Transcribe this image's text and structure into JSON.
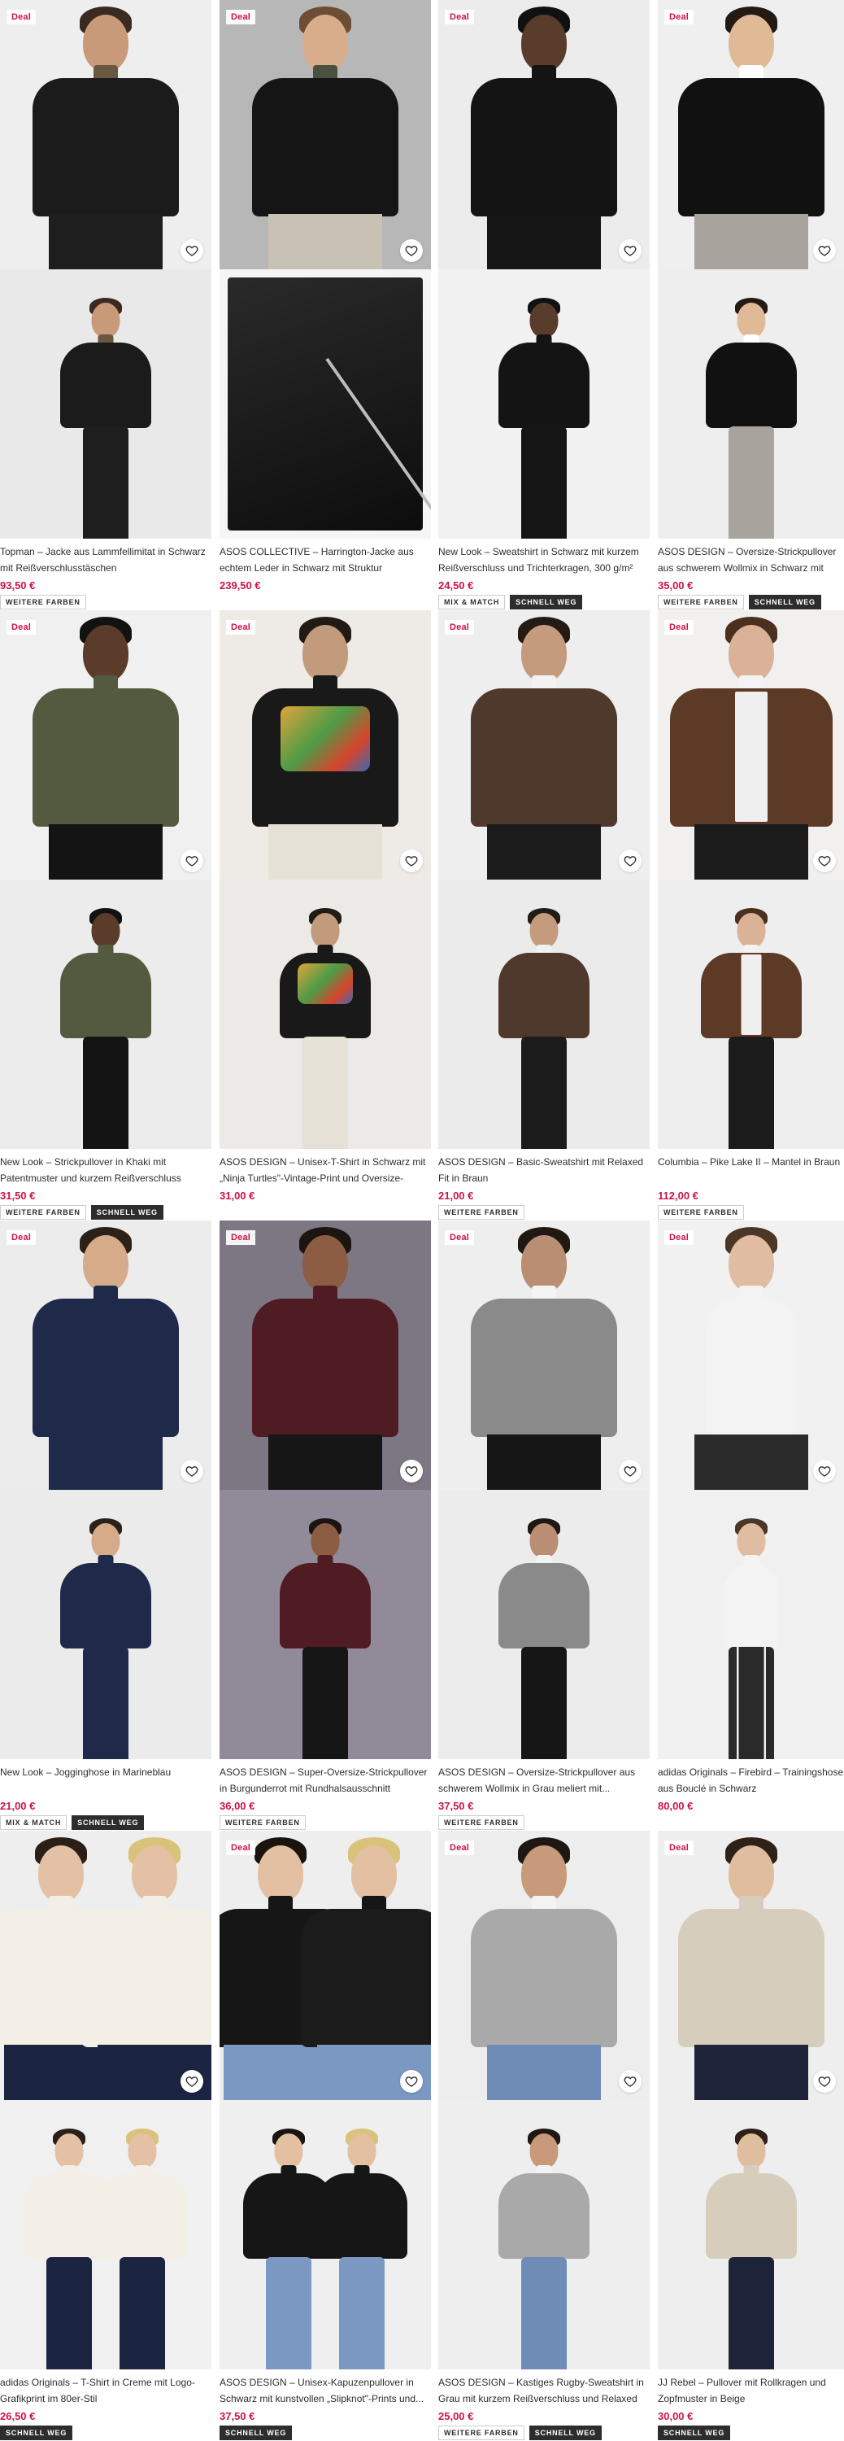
{
  "colors": {
    "deal_text": "#d01345",
    "price_text": "#d01345",
    "tag_dark_bg": "#2d2d2d"
  },
  "icons": {
    "favourite": "heart-outline-icon"
  },
  "products": [
    {
      "deal_label": "Deal",
      "title": "Topman – Jacke aus Lammfellimitat in Schwarz mit Reißverschlusstäschen",
      "price": "93,50 €",
      "tags": [
        "WEITERE FARBEN"
      ]
    },
    {
      "deal_label": "Deal",
      "title": "ASOS COLLECTIVE – Harrington-Jacke aus echtem Leder in Schwarz mit Struktur",
      "price": "239,50 €",
      "tags": []
    },
    {
      "deal_label": "Deal",
      "title": "New Look – Sweatshirt in Schwarz mit kurzem Reißverschluss und Trichterkragen, 300 g/m²",
      "price": "24,50 €",
      "tags": [
        "MIX & MATCH",
        "SCHNELL WEG"
      ]
    },
    {
      "deal_label": "Deal",
      "title": "ASOS DESIGN – Oversize-Strickpullover aus schwerem Wollmix in Schwarz mit Polokragen",
      "price": "35,00 €",
      "tags": [
        "WEITERE FARBEN",
        "SCHNELL WEG"
      ]
    },
    {
      "deal_label": "Deal",
      "title": "New Look – Strickpullover in Khaki mit Patentmuster und kurzem Reißverschluss",
      "price": "31,50 €",
      "tags": [
        "WEITERE FARBEN",
        "SCHNELL WEG"
      ]
    },
    {
      "deal_label": "Deal",
      "title": "ASOS DESIGN – Unisex-T-Shirt in Schwarz mit „Ninja Turtles\"-Vintage-Print und Oversize-Schnitt",
      "price": "31,00 €",
      "tags": []
    },
    {
      "deal_label": "Deal",
      "title": "ASOS DESIGN – Basic-Sweatshirt mit Relaxed Fit in Braun",
      "price": "21,00 €",
      "tags": [
        "WEITERE FARBEN"
      ]
    },
    {
      "deal_label": "Deal",
      "title": "Columbia – Pike Lake II – Mantel in Braun",
      "price": "112,00 €",
      "tags": [
        "WEITERE FARBEN"
      ]
    },
    {
      "deal_label": "Deal",
      "title": "New Look – Jogginghose in Marineblau",
      "price": "21,00 €",
      "tags": [
        "MIX & MATCH",
        "SCHNELL WEG"
      ]
    },
    {
      "deal_label": "Deal",
      "title": "ASOS DESIGN – Super-Oversize-Strickpullover in Burgunderrot mit Rundhalsausschnitt",
      "price": "36,00 €",
      "tags": [
        "WEITERE FARBEN"
      ]
    },
    {
      "deal_label": "Deal",
      "title": "ASOS DESIGN – Oversize-Strickpullover aus schwerem Wollmix in Grau meliert mit...",
      "price": "37,50 €",
      "tags": [
        "WEITERE FARBEN"
      ]
    },
    {
      "deal_label": "Deal",
      "title": "adidas Originals – Firebird – Trainingshose aus Bouclé in Schwarz",
      "price": "80,00 €",
      "tags": []
    },
    {
      "deal_label": "",
      "title": "adidas Originals – T-Shirt in Creme mit Logo-Grafikprint im 80er-Stil",
      "price": "26,50 €",
      "tags": [
        "SCHNELL WEG"
      ]
    },
    {
      "deal_label": "Deal",
      "title": "ASOS DESIGN – Unisex-Kapuzenpullover in Schwarz mit kunstvollen „Slipknot\"-Prints und...",
      "price": "37,50 €",
      "tags": [
        "SCHNELL WEG"
      ]
    },
    {
      "deal_label": "Deal",
      "title": "ASOS DESIGN – Kastiges Rugby-Sweatshirt in Grau mit kurzem Reißverschluss und Relaxed Fit",
      "price": "25,00 €",
      "tags": [
        "WEITERE FARBEN",
        "SCHNELL WEG"
      ]
    },
    {
      "deal_label": "Deal",
      "title": "JJ Rebel – Pullover mit Rollkragen und Zopfmuster in Beige",
      "price": "30,00 €",
      "tags": [
        "SCHNELL WEG"
      ]
    }
  ]
}
